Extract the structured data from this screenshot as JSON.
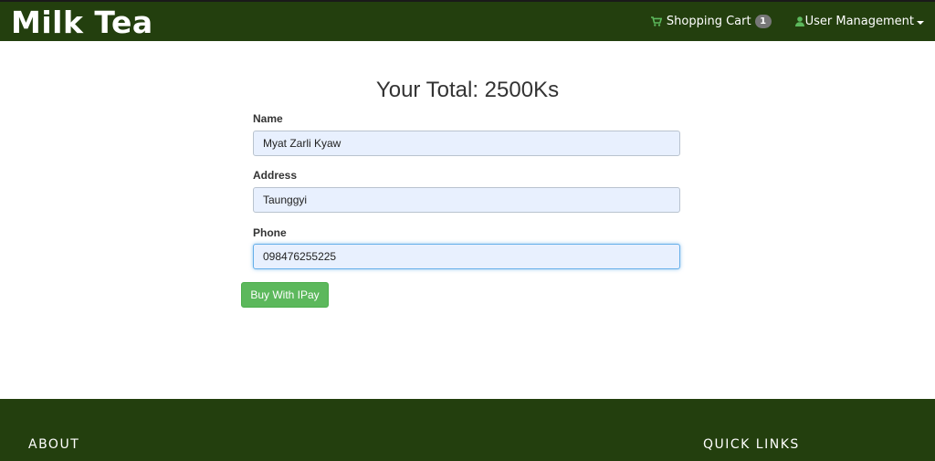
{
  "navbar": {
    "brand": "Milk Tea",
    "cart": {
      "label": "Shopping Cart",
      "icon": "shopping-cart-icon",
      "count": "1"
    },
    "user_menu": {
      "label": "User Management",
      "icon": "user-icon"
    },
    "colors": {
      "background": "#233f0e",
      "icon_accent": "#5cb85c"
    }
  },
  "checkout": {
    "total": "Your Total: 2500Ks",
    "fields": {
      "name": {
        "label": "Name",
        "value": "Myat Zarli Kyaw"
      },
      "address": {
        "label": "Address",
        "value": "Taunggyi"
      },
      "phone": {
        "label": "Phone",
        "value": "098476255225"
      }
    },
    "submit_label": "Buy With IPay",
    "submit_color": "#5cb85c"
  },
  "footer": {
    "about": "ABOUT",
    "quick_links": "QUICK LINKS"
  }
}
